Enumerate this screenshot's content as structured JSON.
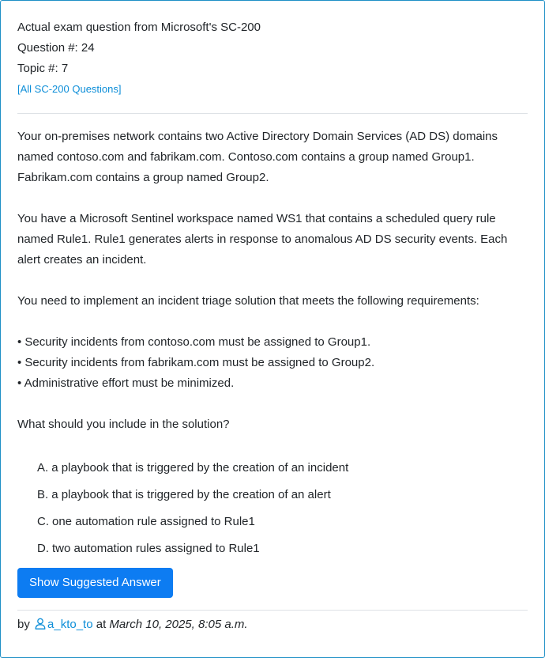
{
  "header": {
    "exam_line": "Actual exam question from Microsoft's SC-200",
    "question_line": "Question #: 24",
    "topic_line": "Topic #: 7",
    "all_link": "[All SC-200 Questions]"
  },
  "body": {
    "para1": "Your on-premises network contains two Active Directory Domain Services (AD DS) domains named contoso.com and fabrikam.com. Contoso.com contains a group named Group1. Fabrikam.com contains a group named Group2.",
    "para2": "You have a Microsoft Sentinel workspace named WS1 that contains a scheduled query rule named Rule1. Rule1 generates alerts in response to anomalous AD DS security events. Each alert creates an incident.",
    "para3": "You need to implement an incident triage solution that meets the following requirements:",
    "bullets": [
      "• Security incidents from contoso.com must be assigned to Group1.",
      "• Security incidents from fabrikam.com must be assigned to Group2.",
      "• Administrative effort must be minimized."
    ],
    "question": "What should you include in the solution?"
  },
  "choices": [
    {
      "letter": "A.",
      "text": "a playbook that is triggered by the creation of an incident"
    },
    {
      "letter": "B.",
      "text": "a playbook that is triggered by the creation of an alert"
    },
    {
      "letter": "C.",
      "text": "one automation rule assigned to Rule1"
    },
    {
      "letter": "D.",
      "text": "two automation rules assigned to Rule1"
    }
  ],
  "actions": {
    "show_answer_label": "Show Suggested Answer"
  },
  "footer": {
    "by_label": "by",
    "username": "a_kto_to",
    "at_label": "at",
    "date": "March 10, 2025, 8:05 a.m.",
    "user_icon": "user-icon"
  },
  "colors": {
    "accent": "#0d7cf2",
    "link": "#0d8ed8",
    "border": "#1f8fc6"
  }
}
